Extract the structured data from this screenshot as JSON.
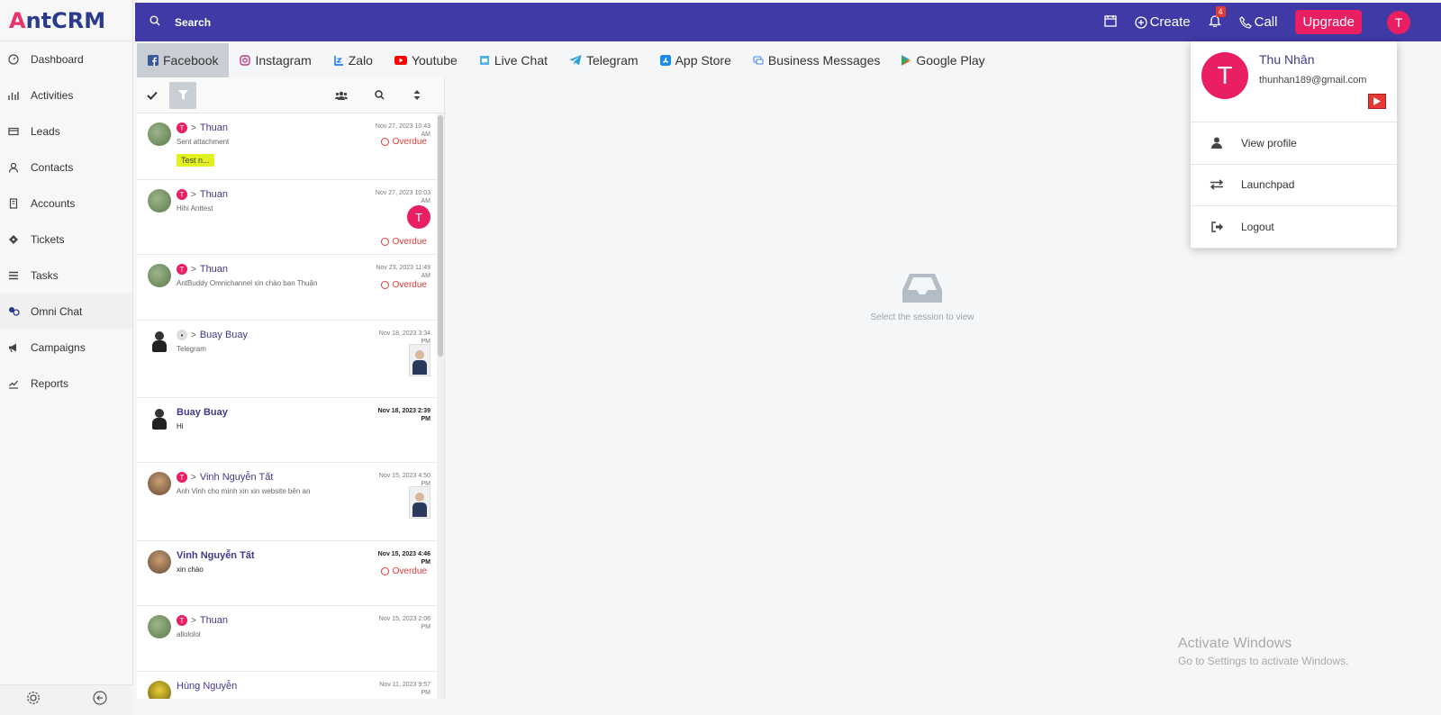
{
  "brand": {
    "logo_mark": "A",
    "logo_text": "ntCRM"
  },
  "sidebar": {
    "items": [
      {
        "label": "Dashboard",
        "icon": "dashboard-icon"
      },
      {
        "label": "Activities",
        "icon": "activities-icon"
      },
      {
        "label": "Leads",
        "icon": "leads-icon"
      },
      {
        "label": "Contacts",
        "icon": "contacts-icon"
      },
      {
        "label": "Accounts",
        "icon": "accounts-icon"
      },
      {
        "label": "Tickets",
        "icon": "tickets-icon"
      },
      {
        "label": "Tasks",
        "icon": "tasks-icon"
      },
      {
        "label": "Omni Chat",
        "icon": "omni-chat-icon",
        "active": true
      },
      {
        "label": "Campaigns",
        "icon": "campaigns-icon"
      },
      {
        "label": "Reports",
        "icon": "reports-icon"
      }
    ]
  },
  "topbar": {
    "search_label": "Search",
    "create_label": "Create",
    "notif_count": "4",
    "call_label": "Call",
    "upgrade_label": "Upgrade",
    "avatar_letter": "T"
  },
  "tabs": [
    {
      "label": "Facebook",
      "icon": "facebook-icon",
      "active": true
    },
    {
      "label": "Instagram",
      "icon": "instagram-icon"
    },
    {
      "label": "Zalo",
      "icon": "zalo-icon"
    },
    {
      "label": "Youtube",
      "icon": "youtube-icon"
    },
    {
      "label": "Live Chat",
      "icon": "live-chat-icon"
    },
    {
      "label": "Telegram",
      "icon": "telegram-icon"
    },
    {
      "label": "App Store",
      "icon": "app-store-icon"
    },
    {
      "label": "Business Messages",
      "icon": "business-messages-icon"
    },
    {
      "label": "Google Play",
      "icon": "google-play-icon"
    }
  ],
  "conversations": [
    {
      "name": "Thuan",
      "preview": "Sent attachment",
      "date_line1": "Nov 27, 2023 10:43",
      "date_line2": "AM",
      "overdue": "Overdue",
      "tag": "Test n...",
      "avatar": "green",
      "height": 74
    },
    {
      "name": "Thuan",
      "preview": "Hihi Anttest",
      "date_line1": "Nov 27, 2023 10:03",
      "date_line2": "AM",
      "overdue": "Overdue",
      "agent": "T",
      "avatar": "green",
      "height": 83
    },
    {
      "name": "Thuan",
      "preview": "AntBuddy Omnichannel xin chào bạn Thuận",
      "date_line1": "Nov 23, 2023 11:49",
      "date_line2": "AM",
      "overdue": "Overdue",
      "avatar": "green",
      "height": 73
    },
    {
      "name": "Buay Buay",
      "preview": "Telegram",
      "date_line1": "Nov 18, 2023 3:34",
      "date_line2": "PM",
      "thumb": true,
      "avatar": "man",
      "badge_small": true,
      "height": 86
    },
    {
      "name": "Buay Buay",
      "preview": "Hi",
      "date_line1": "Nov 18, 2023 2:39",
      "date_line2": "PM",
      "avatar": "man",
      "unread": true,
      "height": 72
    },
    {
      "name": "Vinh Nguyễn Tất",
      "preview": "Anh Vinh cho mình xin xin website bên an",
      "date_line1": "Nov 15, 2023 4:50",
      "date_line2": "PM",
      "thumb": true,
      "avatar": "brown",
      "height": 87
    },
    {
      "name": "Vinh Nguyễn Tất",
      "preview": "xin chào",
      "date_line1": "Nov 15, 2023 4:46",
      "date_line2": "PM",
      "overdue": "Overdue",
      "avatar": "brown",
      "unread": true,
      "height": 72
    },
    {
      "name": "Thuan",
      "preview": "allololol",
      "date_line1": "Nov 15, 2023 2:06",
      "date_line2": "PM",
      "avatar": "green",
      "height": 73
    },
    {
      "name": "Hùng Nguyễn",
      "preview": "",
      "date_line1": "Nov 11, 2023 9:57",
      "date_line2": "PM",
      "avatar": "yellow",
      "nobadge": true,
      "height": 40
    }
  ],
  "main": {
    "empty_label": "Select the session to view"
  },
  "profile": {
    "letter": "T",
    "name": "Thu Nhân",
    "email": "thunhan189@gmail.com",
    "menu": [
      {
        "label": "View profile",
        "icon": "user-icon"
      },
      {
        "label": "Launchpad",
        "icon": "swap-arrows-icon"
      },
      {
        "label": "Logout",
        "icon": "logout-icon"
      }
    ]
  },
  "watermark": {
    "line1": "Activate Windows",
    "line2": "Go to Settings to activate Windows."
  },
  "colors": {
    "topbar": "#3f3aa5",
    "accent": "#e91e63",
    "overdue": "#e53935",
    "tag": "#e1f01f"
  }
}
